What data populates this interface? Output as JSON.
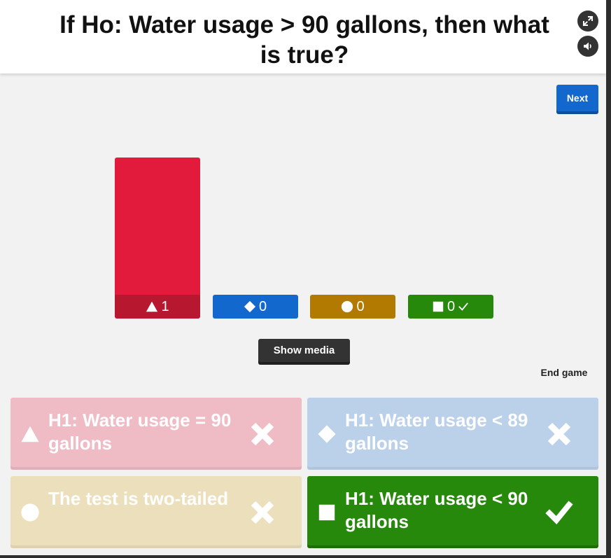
{
  "header": {
    "question": "If Ho: Water usage > 90 gallons, then what is true?",
    "fullscreen_icon": "fullscreen-icon",
    "sound_icon": "speaker-icon"
  },
  "controls": {
    "next_label": "Next",
    "show_media_label": "Show media",
    "end_game_label": "End game"
  },
  "chart_data": {
    "type": "bar",
    "categories": [
      "triangle",
      "diamond",
      "circle",
      "square"
    ],
    "values": [
      1,
      0,
      0,
      0
    ],
    "colors": [
      "#e21b3c",
      "#1368ce",
      "#b27a00",
      "#26890c"
    ],
    "label_colors": [
      "#b7172f",
      "#1056ab",
      "#9b6a00",
      "#1f720a"
    ],
    "correct": [
      false,
      false,
      false,
      true
    ],
    "ylim": [
      0,
      1
    ]
  },
  "answers": [
    {
      "shape": "triangle-icon",
      "text": "H1: Water usage = 90 gallons",
      "correct": false,
      "bg": "#efbbc5",
      "mark": "cross-icon"
    },
    {
      "shape": "diamond-icon",
      "text": "H1: Water usage < 89 gallons",
      "correct": false,
      "bg": "#bbd1ea",
      "mark": "cross-icon"
    },
    {
      "shape": "circle-icon",
      "text": "The test is two-tailed",
      "correct": false,
      "bg": "#ecdfbb",
      "mark": "cross-icon"
    },
    {
      "shape": "square-icon",
      "text": "H1: Water usage < 90 gallons",
      "correct": true,
      "bg": "#26890c",
      "mark": "check-icon"
    }
  ]
}
